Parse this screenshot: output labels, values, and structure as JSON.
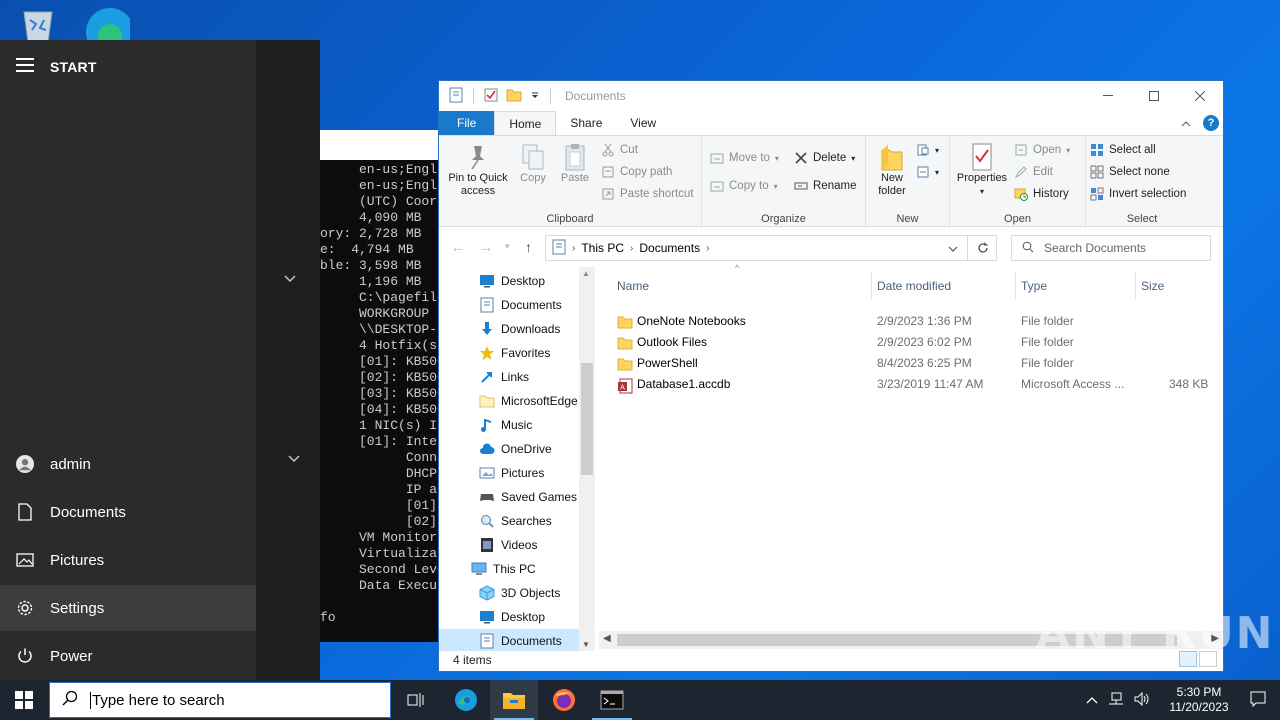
{
  "console": {
    "lines": [
      "     en-us;Engli",
      "     en-us;Engli",
      "     (UTC) Coord",
      "     4,090 MB",
      "ory: 2,728 MB",
      "e:  4,794 MB",
      "ble: 3,598 MB",
      "     1,196 MB",
      "     C:\\pagefile",
      "     WORKGROUP",
      "     \\\\DESKTOP-J",
      "     4 Hotfix(s)",
      "     [01]: KB500",
      "     [02]: KB500",
      "     [03]: KB500",
      "     [04]: KB500",
      "     1 NIC(s) In",
      "     [01]: Intel",
      "           Conne",
      "           DHCP",
      "           IP ad",
      "           [01]:",
      "           [02]:",
      "     VM Monitor",
      "     Virtualizat",
      "     Second Leve",
      "     Data Execut",
      "",
      "fo"
    ]
  },
  "start_menu": {
    "title": "START",
    "user": "admin",
    "items": [
      "Documents",
      "Pictures",
      "Settings",
      "Power"
    ]
  },
  "explorer": {
    "title": "Documents",
    "tabs": [
      "File",
      "Home",
      "Share",
      "View"
    ],
    "ribbon": {
      "clipboard": {
        "label": "Clipboard",
        "pin": "Pin to Quick access",
        "copy": "Copy",
        "paste": "Paste",
        "cut": "Cut",
        "copy_path": "Copy path",
        "paste_shortcut": "Paste shortcut"
      },
      "organize": {
        "label": "Organize",
        "move_to": "Move to",
        "copy_to": "Copy to",
        "delete": "Delete",
        "rename": "Rename"
      },
      "new": {
        "label": "New",
        "new_folder": "New folder"
      },
      "open": {
        "label": "Open",
        "properties": "Properties",
        "open": "Open",
        "edit": "Edit",
        "history": "History"
      },
      "select": {
        "label": "Select",
        "select_all": "Select all",
        "select_none": "Select none",
        "invert": "Invert selection"
      }
    },
    "address": {
      "segments": [
        "This PC",
        "Documents"
      ]
    },
    "search_placeholder": "Search Documents",
    "nav_items": [
      {
        "label": "Desktop",
        "icon": "desktop-icon"
      },
      {
        "label": "Documents",
        "icon": "documents-icon"
      },
      {
        "label": "Downloads",
        "icon": "downloads-icon"
      },
      {
        "label": "Favorites",
        "icon": "star-icon"
      },
      {
        "label": "Links",
        "icon": "links-icon"
      },
      {
        "label": "MicrosoftEdge",
        "icon": "folder-icon"
      },
      {
        "label": "Music",
        "icon": "music-icon"
      },
      {
        "label": "OneDrive",
        "icon": "cloud-icon"
      },
      {
        "label": "Pictures",
        "icon": "pictures-icon"
      },
      {
        "label": "Saved Games",
        "icon": "games-icon"
      },
      {
        "label": "Searches",
        "icon": "search-icon"
      },
      {
        "label": "Videos",
        "icon": "videos-icon"
      },
      {
        "label": "This PC",
        "icon": "computer-icon"
      },
      {
        "label": "3D Objects",
        "icon": "cube-icon"
      },
      {
        "label": "Desktop",
        "icon": "desktop-icon"
      },
      {
        "label": "Documents",
        "icon": "documents-icon"
      }
    ],
    "columns": [
      "Name",
      "Date modified",
      "Type",
      "Size"
    ],
    "files": [
      {
        "name": "OneNote Notebooks",
        "date": "2/9/2023 1:36 PM",
        "type": "File folder",
        "size": ""
      },
      {
        "name": "Outlook Files",
        "date": "2/9/2023 6:02 PM",
        "type": "File folder",
        "size": ""
      },
      {
        "name": "PowerShell",
        "date": "8/4/2023 6:25 PM",
        "type": "File folder",
        "size": ""
      },
      {
        "name": "Database1.accdb",
        "date": "3/23/2019 11:47 AM",
        "type": "Microsoft Access ...",
        "size": "348 KB"
      }
    ],
    "status": "4 items"
  },
  "taskbar": {
    "search_placeholder": "Type here to search",
    "time": "5:30 PM",
    "date": "11/20/2023"
  },
  "watermark": "ANY RUN",
  "colors": {
    "accent": "#1979ca",
    "taskbar": "#1d2630",
    "start": "#2b2b2b"
  }
}
